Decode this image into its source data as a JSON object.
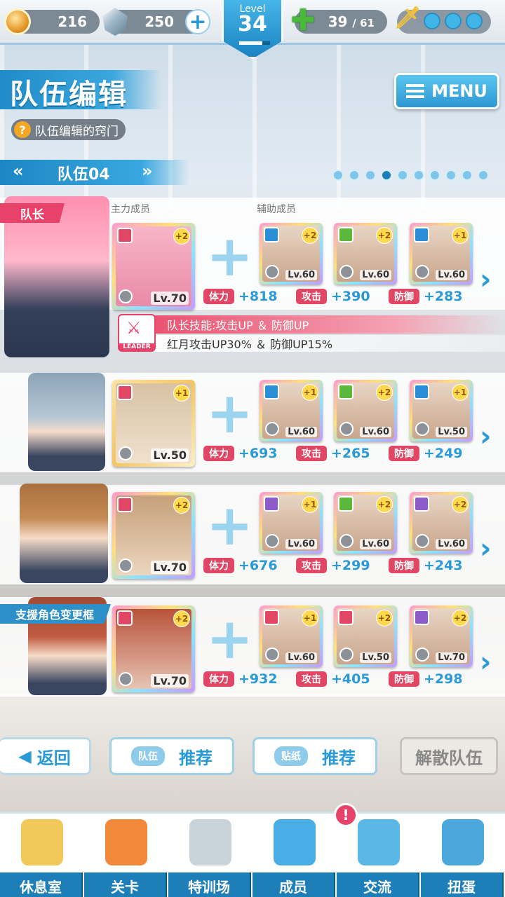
{
  "topbar": {
    "coins": "216",
    "gems": "250",
    "level_label": "Level",
    "level": "34",
    "level_progress": 0.75,
    "stamina_current": "39",
    "stamina_max": "/ 61"
  },
  "title": "队伍编辑",
  "help_label": "队伍编辑的窍门",
  "menu_label": "MENU",
  "team": {
    "name": "队伍04",
    "prev": "«",
    "next": "»",
    "pages": 10,
    "current_page": 4
  },
  "labels": {
    "main_member": "主力成员",
    "support_member": "辅助成员",
    "leader_tag": "队长",
    "support_tag": "支援角色变更框"
  },
  "rows": [
    {
      "main_lv": "Lv.70",
      "main_rank": "+2",
      "subs": [
        {
          "lv": "Lv.60",
          "rank": "+2",
          "attr": "#2a8fd6"
        },
        {
          "lv": "Lv.60",
          "rank": "+2",
          "attr": "#5cb83a"
        },
        {
          "lv": "Lv.60",
          "rank": "+1",
          "attr": "#2a8fd6"
        }
      ],
      "stats": [
        {
          "label": "体力",
          "value": "+818"
        },
        {
          "label": "攻击",
          "value": "+390"
        },
        {
          "label": "防御",
          "value": "+283"
        }
      ]
    },
    {
      "main_lv": "Lv.50",
      "main_rank": "+1",
      "subs": [
        {
          "lv": "Lv.60",
          "rank": "+1",
          "attr": "#2a8fd6"
        },
        {
          "lv": "Lv.60",
          "rank": "+2",
          "attr": "#5cb83a"
        },
        {
          "lv": "Lv.50",
          "rank": "+1",
          "attr": "#2a8fd6"
        }
      ],
      "stats": [
        {
          "label": "体力",
          "value": "+693"
        },
        {
          "label": "攻击",
          "value": "+265"
        },
        {
          "label": "防御",
          "value": "+249"
        }
      ]
    },
    {
      "main_lv": "Lv.70",
      "main_rank": "+2",
      "subs": [
        {
          "lv": "Lv.60",
          "rank": "+1",
          "attr": "#8e5cc8"
        },
        {
          "lv": "Lv.60",
          "rank": "+2",
          "attr": "#5cb83a"
        },
        {
          "lv": "Lv.60",
          "rank": "+2",
          "attr": "#8e5cc8"
        }
      ],
      "stats": [
        {
          "label": "体力",
          "value": "+676"
        },
        {
          "label": "攻击",
          "value": "+299"
        },
        {
          "label": "防御",
          "value": "+243"
        }
      ]
    },
    {
      "main_lv": "Lv.70",
      "main_rank": "+2",
      "subs": [
        {
          "lv": "Lv.60",
          "rank": "+1",
          "attr": "#e14665"
        },
        {
          "lv": "Lv.50",
          "rank": "+2",
          "attr": "#e14665"
        },
        {
          "lv": "Lv.70",
          "rank": "+2",
          "attr": "#8e5cc8"
        }
      ],
      "stats": [
        {
          "label": "体力",
          "value": "+932"
        },
        {
          "label": "攻击",
          "value": "+405"
        },
        {
          "label": "防御",
          "value": "+298"
        }
      ]
    }
  ],
  "leader_skill": {
    "badge": "LEADER",
    "title": "队长技能:攻击UP ＆ 防御UP",
    "desc": "红月攻击UP30% ＆ 防御UP15%"
  },
  "buttons": {
    "back": "返回",
    "team_sub": "队伍",
    "team_label": "推荐",
    "sticker_sub": "贴纸",
    "sticker_label": "推荐",
    "disband": "解散队伍"
  },
  "nav": [
    {
      "label": "休息室",
      "icon": "school-icon"
    },
    {
      "label": "关卡",
      "icon": "demon-icon"
    },
    {
      "label": "特训场",
      "icon": "crossed-swords-icon"
    },
    {
      "label": "成员",
      "icon": "cat-mascot-icon"
    },
    {
      "label": "交流",
      "icon": "uniform-icon"
    },
    {
      "label": "扭蛋",
      "icon": "curtain-icon"
    }
  ],
  "nav_badge": "!"
}
